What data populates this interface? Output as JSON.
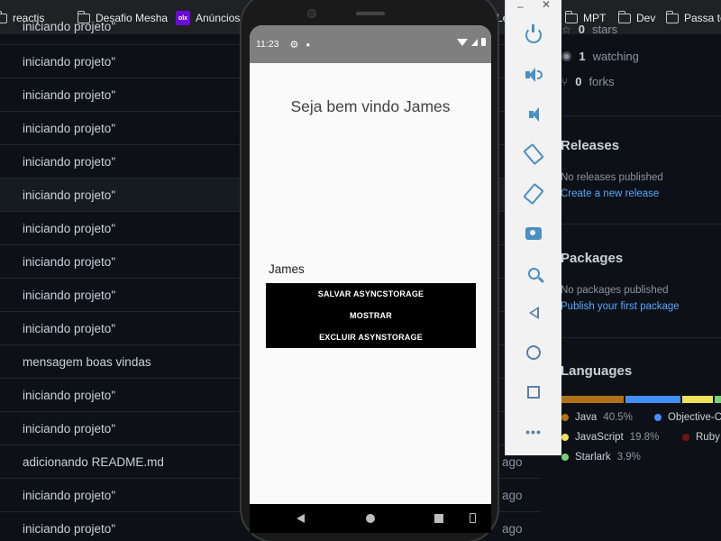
{
  "bookmarks": {
    "items": [
      {
        "label": "reactjs"
      },
      {
        "label": "Desafio Mesha"
      },
      {
        "label": "Anúncios"
      },
      {
        "label": "MPT"
      },
      {
        "label": "Dev"
      },
      {
        "label": "Passa te"
      }
    ],
    "partial": "Le",
    "olx_badge": "olx"
  },
  "commits": [
    {
      "message": "iniciando projeto\"",
      "ago": ""
    },
    {
      "message": "iniciando projeto\"",
      "ago": ""
    },
    {
      "message": "iniciando projeto\"",
      "ago": ""
    },
    {
      "message": "iniciando projeto\"",
      "ago": ""
    },
    {
      "message": "iniciando projeto\"",
      "ago": ""
    },
    {
      "message": "iniciando projeto\"",
      "ago": ""
    },
    {
      "message": "iniciando projeto\"",
      "ago": ""
    },
    {
      "message": "iniciando projeto\"",
      "ago": ""
    },
    {
      "message": "iniciando projeto\"",
      "ago": ""
    },
    {
      "message": "iniciando projeto\"",
      "ago": ""
    },
    {
      "message": "mensagem boas vindas",
      "ago": ""
    },
    {
      "message": "iniciando projeto\"",
      "ago": ""
    },
    {
      "message": "iniciando projeto\"",
      "ago": ""
    },
    {
      "message": "adicionando README.md",
      "ago": "ago"
    },
    {
      "message": "iniciando projeto\"",
      "ago": "ago"
    },
    {
      "message": "iniciando projeto\"",
      "ago": "ago"
    }
  ],
  "sidebar": {
    "stars": {
      "count": "0",
      "label": "stars"
    },
    "watching": {
      "count": "1",
      "label": "watching"
    },
    "forks": {
      "count": "0",
      "label": "forks"
    },
    "releases": {
      "title": "Releases",
      "empty": "No releases published",
      "link": "Create a new release"
    },
    "packages": {
      "title": "Packages",
      "empty": "No packages published",
      "link": "Publish your first package"
    },
    "languages": {
      "title": "Languages",
      "items": [
        {
          "name": "Java",
          "percent": "40.5%",
          "color": "#b07219"
        },
        {
          "name": "Objective-C",
          "percent": "",
          "color": "#438eff"
        },
        {
          "name": "JavaScript",
          "percent": "19.8%",
          "color": "#f1e05a"
        },
        {
          "name": "Ruby",
          "percent": "",
          "color": "#701516"
        },
        {
          "name": "Starlark",
          "percent": "3.9%",
          "color": "#76d275"
        }
      ],
      "bar": [
        {
          "color": "#b07219",
          "share": 40.5
        },
        {
          "color": "#438eff",
          "share": 35.8
        },
        {
          "color": "#f1e05a",
          "share": 19.8
        },
        {
          "color": "#76d275",
          "share": 3.9
        }
      ]
    }
  },
  "phone": {
    "time": "11:23",
    "welcome": "Seja bem vindo James",
    "name": "James",
    "buttons": {
      "save": "SALVAR ASYNCSTORAGE",
      "show": "MOSTRAR",
      "delete": "EXCLUIR ASYNSTORAGE"
    }
  },
  "emulator": {
    "minimize": "–",
    "close": "✕",
    "more": "•••"
  }
}
